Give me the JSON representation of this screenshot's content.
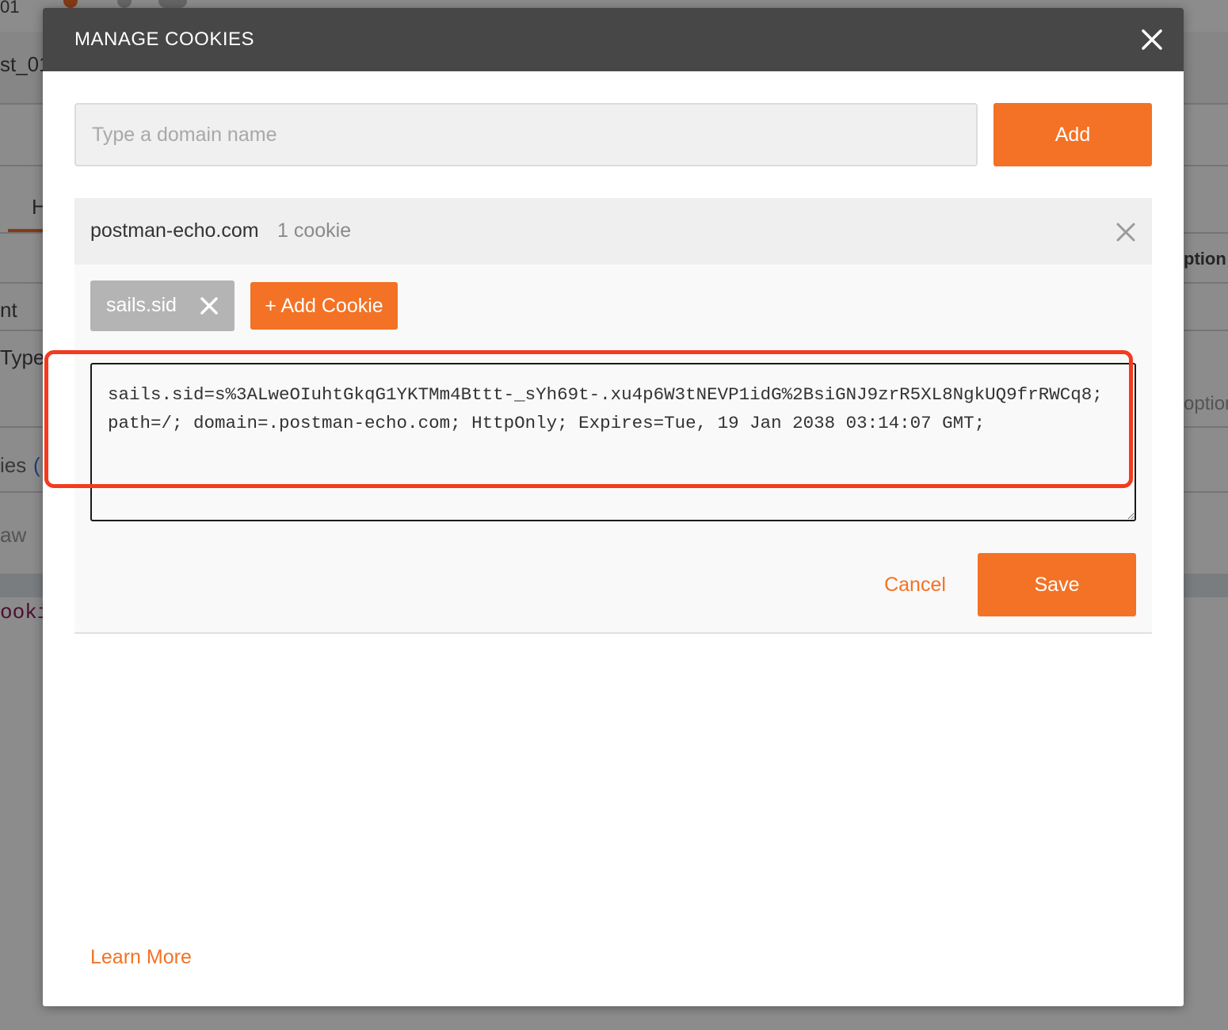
{
  "background_app": {
    "fragments": {
      "top_left": "01",
      "request_name": "st_01",
      "tab_letter": "H",
      "right_header": "ption",
      "row_nt": "nt",
      "row_type": "Type",
      "right_row": "option",
      "cookies_label": "ies",
      "cookies_paren": "(",
      "raw_label": "aw",
      "code_token": "ooki"
    }
  },
  "modal": {
    "title": "MANAGE COOKIES",
    "close_icon": "close-icon",
    "domain_input": {
      "placeholder": "Type a domain name",
      "value": ""
    },
    "add_button_label": "Add",
    "domain": {
      "name": "postman-echo.com",
      "count_label": "1 cookie",
      "remove_icon": "close-icon"
    },
    "cookie_chip": {
      "label": "sails.sid",
      "remove_icon": "close-icon"
    },
    "add_cookie_label": "+ Add Cookie",
    "cookie_value": "sails.sid=s%3ALweOIuhtGkqG1YKTMm4Bttt-_sYh69t-.xu4p6W3tNEVP1idG%2BsiGNJ9zrR5XL8NgkUQ9frRWCq8; path=/; domain=.postman-echo.com; HttpOnly; Expires=Tue, 19 Jan 2038 03:14:07 GMT;",
    "cancel_label": "Cancel",
    "save_label": "Save",
    "learn_more_label": "Learn More"
  },
  "colors": {
    "accent": "#f37225",
    "header_bg": "#474747",
    "highlight": "#f53a1e"
  }
}
